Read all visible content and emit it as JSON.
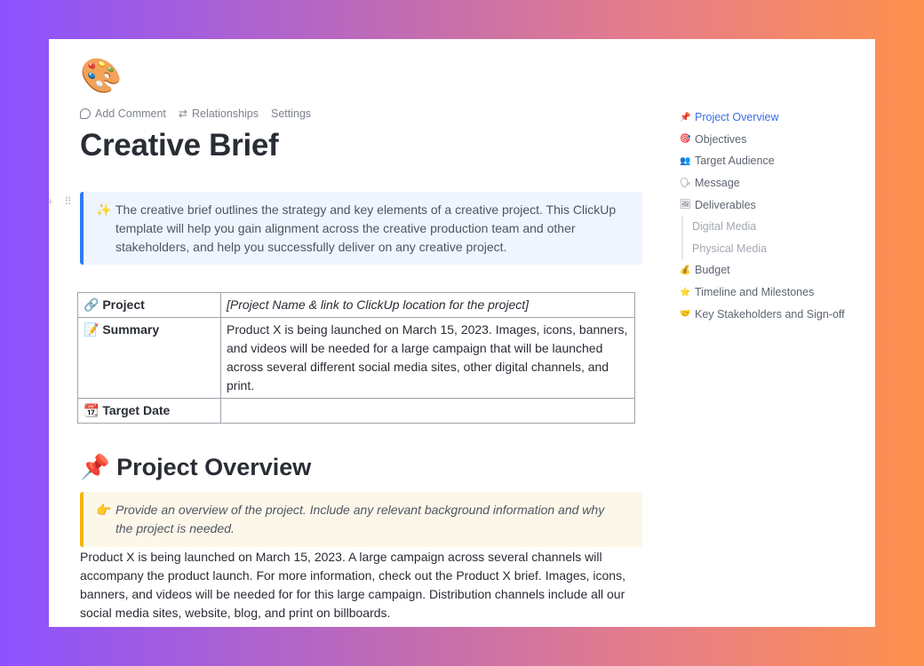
{
  "page": {
    "icon": "🎨",
    "icon_name": "artist-palette-icon",
    "title": "Creative Brief"
  },
  "actions": [
    {
      "label": "Add Comment",
      "icon": "comment-icon"
    },
    {
      "label": "Relationships",
      "icon": "relationships-icon",
      "glyph": "⇄"
    },
    {
      "label": "Settings"
    }
  ],
  "gutter": {
    "add": "+",
    "drag": "⠿"
  },
  "intro_callout": {
    "emoji": "✨",
    "text": "The creative brief outlines the strategy and key elements of a creative project. This ClickUp template will help you gain alignment across the creative production team and other stakeholders, and help you successfully deliver on any creative project."
  },
  "brief_table": {
    "rows": [
      {
        "emoji": "🔗",
        "key": "Project",
        "value": "[Project Name & link to ClickUp location for the project]",
        "italic": true
      },
      {
        "emoji": "📝",
        "key": "Summary",
        "value": "Product X is being launched on March 15, 2023. Images, icons, banners, and videos will be needed for a large campaign that will be launched across several different social media sites, other digital channels, and print."
      },
      {
        "emoji": "📆",
        "key": "Target Date",
        "value": ""
      }
    ]
  },
  "overview": {
    "emoji": "📌",
    "heading": "Project Overview",
    "callout_emoji": "👉",
    "callout_text": "Provide an overview of the project. Include any relevant background information and why the project is needed.",
    "body": "Product X is being launched on March 15, 2023. A large campaign across several channels will accompany the product launch. For more information, check out the Product X brief. Images, icons, banners, and videos will be needed for for this large campaign. Distribution channels include all our social media sites, website, blog, and print on billboards."
  },
  "toc": {
    "items": [
      {
        "emoji": "📌",
        "label": "Project Overview",
        "active": true
      },
      {
        "emoji": "🎯",
        "label": "Objectives"
      },
      {
        "emoji": "👥",
        "label": "Target Audience"
      },
      {
        "emoji": "🗣",
        "label": "Message"
      },
      {
        "emoji": "🖼",
        "label": "Deliverables"
      },
      {
        "label": "Digital Media",
        "sub": true
      },
      {
        "label": "Physical Media",
        "sub": true
      },
      {
        "emoji": "💰",
        "label": "Budget"
      },
      {
        "emoji": "⭐",
        "label": "Timeline and Milestones"
      },
      {
        "emoji": "🤝",
        "label": "Key Stakeholders and Sign-off"
      }
    ]
  },
  "colors": {
    "accent": "#3b6ee8",
    "info_border": "#2e7cf6",
    "warn_border": "#f5b400"
  }
}
